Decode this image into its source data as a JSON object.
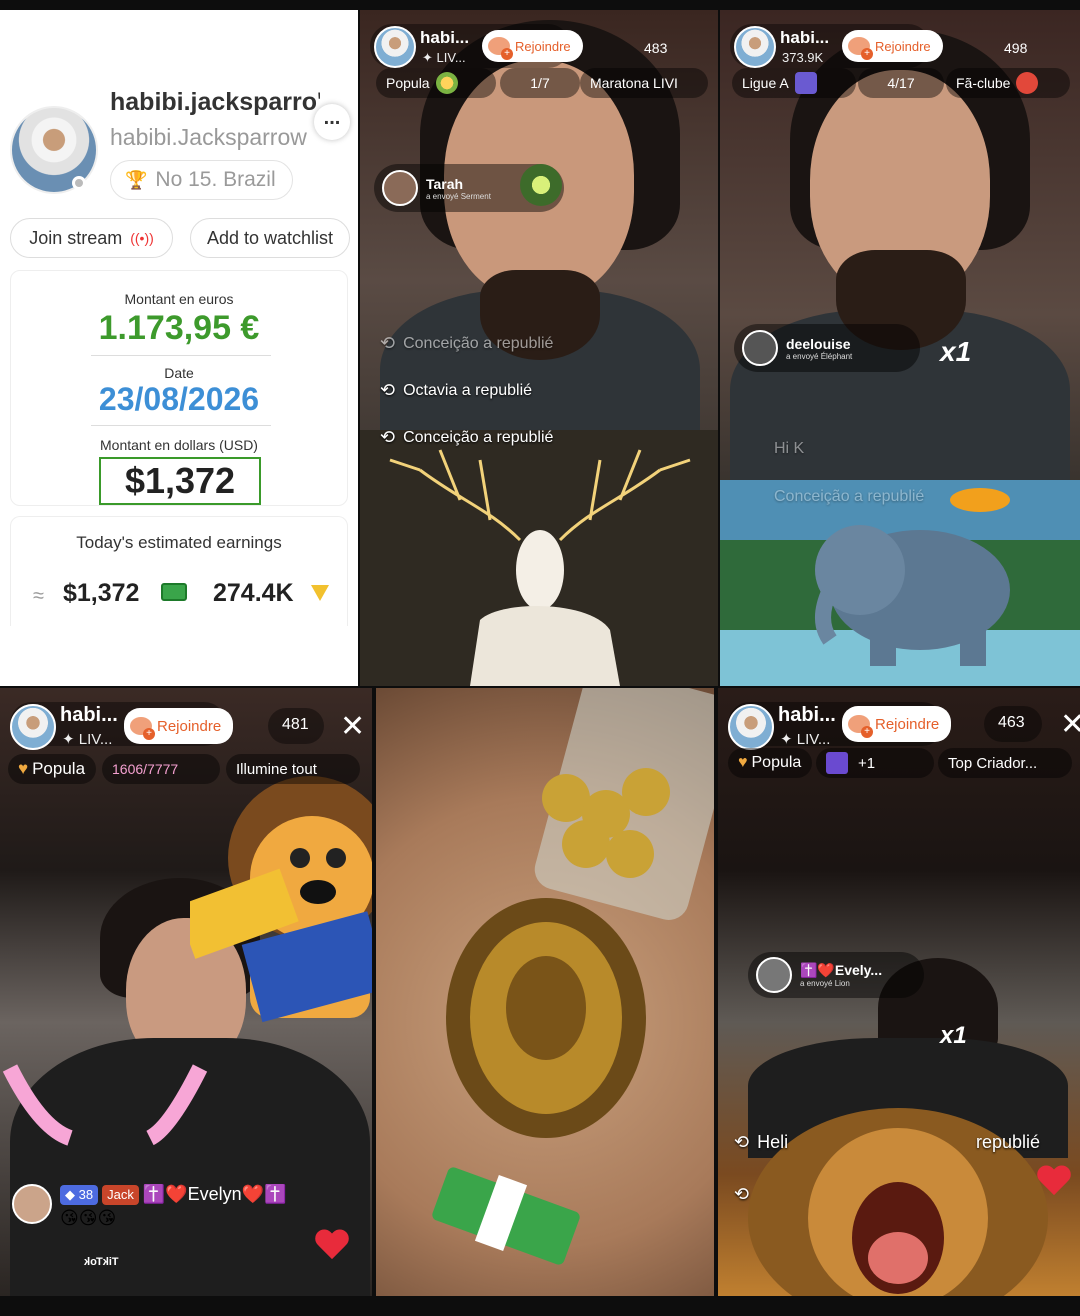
{
  "profile": {
    "display_name": "habibi.jacksparro'",
    "more_label": "...",
    "handle": "habibi.Jacksparrow",
    "rank": "No 15. Brazil",
    "join_stream": "Join stream",
    "add_watchlist": "Add to watchlist",
    "euro_label": "Montant en euros",
    "euro_value": "1.173,95 €",
    "date_label": "Date",
    "date_value": "23/08/2026",
    "usd_label": "Montant en dollars (USD)",
    "usd_value": "$1,372",
    "earnings_title": "Today's estimated earnings",
    "approx": "≈",
    "earnings_usd": "$1,372",
    "earnings_diamonds": "274.4K"
  },
  "panel_deer": {
    "host": "habi...",
    "host_sub": "✦ LIV...",
    "join": "Rejoindre",
    "viewers": "483",
    "chip_left": "Popula",
    "chip_mid": "1/7",
    "chip_right": "Maratona LIVI",
    "gift_user": "Tarah",
    "gift_sub": "a envoyé Serment",
    "comments": [
      "Conceição a republié",
      "Octavia a republié",
      "Conceição a republié"
    ]
  },
  "panel_elephant": {
    "host": "habi...",
    "host_sub": "373.9K",
    "join": "Rejoindre",
    "viewers": "498",
    "chip_left": "Ligue A",
    "chip_mid": "4/17",
    "chip_right": "Fã-clube",
    "gift_user": "deelouise",
    "gift_sub": "a envoyé Éléphant",
    "gift_count": "x1",
    "comment_1": "Hi K",
    "comment_2": "Conceição a republié"
  },
  "panel_bear": {
    "host": "habi...",
    "host_sub": "✦ LIV...",
    "join": "Rejoindre",
    "viewers": "481",
    "close": "✕",
    "chip_left": "Popula",
    "chip_mid": "1606/7777",
    "chip_right": "Illumine tout",
    "badge_level": "38",
    "badge_name": "Jack",
    "commenter": "✝️❤️Evelyn❤️✝️",
    "emojis": "😘😘😘",
    "watermark": "TikTok"
  },
  "panel_lion": {
    "host": "habi...",
    "host_sub": "✦ LIV...",
    "join": "Rejoindre",
    "viewers": "463",
    "close": "✕",
    "chip_left": "Popula",
    "chip_mid": "+1",
    "chip_right": "Top Criador...",
    "gift_user": "✝️❤️Evely...",
    "gift_sub": "a envoyé Lion",
    "gift_count": "x1",
    "comment": "Heli",
    "comment_right": "republié"
  },
  "colors": {
    "euro_green": "#3d9a2c",
    "date_blue": "#3d8fd6",
    "join_orange": "#e5602b",
    "heart_red": "#e82b3b",
    "gold": "#d4a93a"
  },
  "icons": [
    "trophy-icon",
    "live-icon",
    "cash-icon",
    "diamond-icon",
    "repost-icon",
    "heart-icon",
    "close-icon",
    "more-icon"
  ]
}
